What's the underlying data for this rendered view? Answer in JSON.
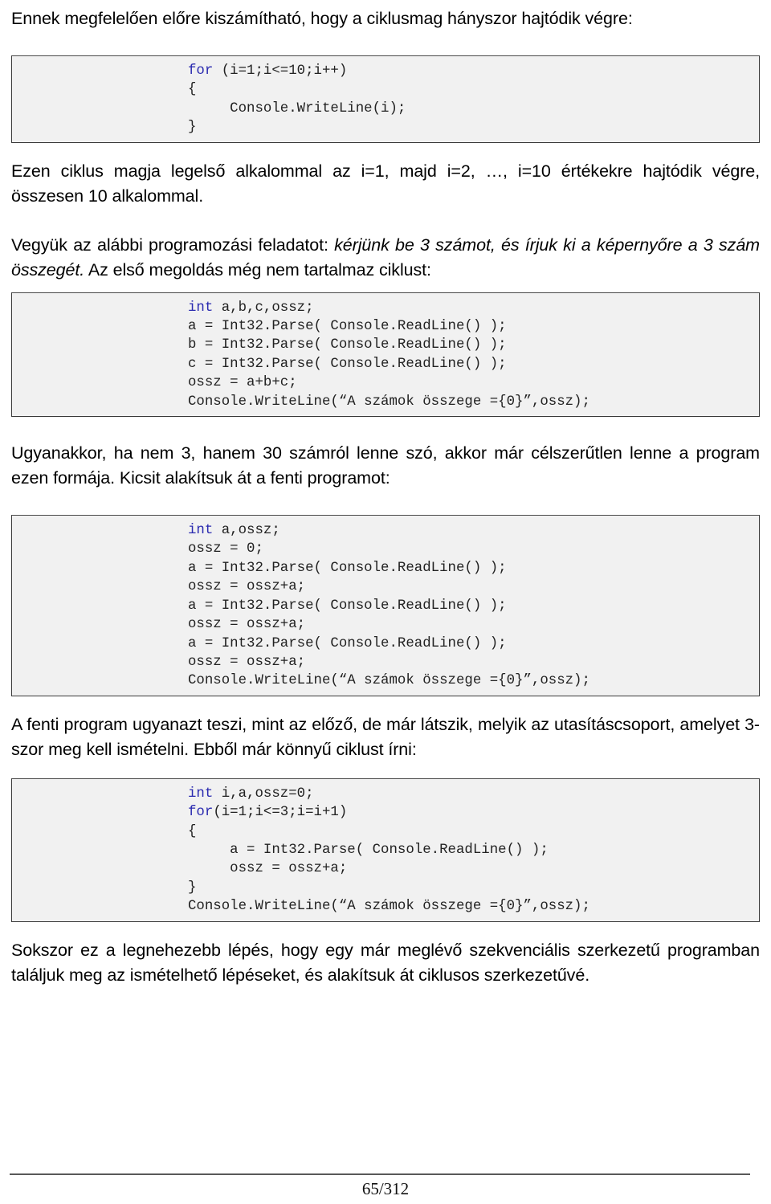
{
  "document": {
    "language": "hu",
    "page_number": "65/312"
  },
  "intro": {
    "heading": "Ennek megfelelően előre kiszámítható, hogy a ciklusmag hányszor hajtódik végre:"
  },
  "code_blocks": [
    {
      "id": "for-loop-10",
      "lines": [
        {
          "keyword": "for",
          "rest": " (i=1;i<=10;i++)"
        },
        {
          "keyword": "",
          "rest": "{"
        },
        {
          "keyword": "",
          "rest": "     Console.WriteLine(i);"
        },
        {
          "keyword": "",
          "rest": "}"
        }
      ]
    },
    {
      "id": "three-numbers-no-loop",
      "lines": [
        {
          "keyword": "int",
          "rest": " a,b,c,ossz;"
        },
        {
          "keyword": "",
          "rest": "a = Int32.Parse( Console.ReadLine() );"
        },
        {
          "keyword": "",
          "rest": "b = Int32.Parse( Console.ReadLine() );"
        },
        {
          "keyword": "",
          "rest": "c = Int32.Parse( Console.ReadLine() );"
        },
        {
          "keyword": "",
          "rest": "ossz = a+b+c;"
        },
        {
          "keyword": "",
          "rest": "Console.WriteLine(“A számok összege ={0}”,ossz);"
        }
      ]
    },
    {
      "id": "three-numbers-unrolled",
      "lines": [
        {
          "keyword": "int",
          "rest": " a,ossz;"
        },
        {
          "keyword": "",
          "rest": "ossz = 0;"
        },
        {
          "keyword": "",
          "rest": "a = Int32.Parse( Console.ReadLine() );"
        },
        {
          "keyword": "",
          "rest": "ossz = ossz+a;"
        },
        {
          "keyword": "",
          "rest": "a = Int32.Parse( Console.ReadLine() );"
        },
        {
          "keyword": "",
          "rest": "ossz = ossz+a;"
        },
        {
          "keyword": "",
          "rest": "a = Int32.Parse( Console.ReadLine() );"
        },
        {
          "keyword": "",
          "rest": "ossz = ossz+a;"
        },
        {
          "keyword": "",
          "rest": "Console.WriteLine(“A számok összege ={0}”,ossz);"
        }
      ]
    },
    {
      "id": "three-numbers-with-loop",
      "lines": [
        {
          "keyword": "int",
          "rest": " i,a,ossz=0;"
        },
        {
          "keyword": "for",
          "rest": "(i=1;i<=3;i=i+1)"
        },
        {
          "keyword": "",
          "rest": "{"
        },
        {
          "keyword": "",
          "rest": "     a = Int32.Parse( Console.ReadLine() );"
        },
        {
          "keyword": "",
          "rest": "     ossz = ossz+a;"
        },
        {
          "keyword": "",
          "rest": "}"
        },
        {
          "keyword": "",
          "rest": "Console.WriteLine(“A számok összege ={0}”,ossz);"
        }
      ]
    }
  ],
  "paragraphs": {
    "after_block1": "Ezen ciklus magja legelső alkalommal az i=1, majd i=2, …, i=10 értékekre hajtódik végre, összesen 10 alkalommal.",
    "task_lead": "Vegyük az alábbi programozási feladatot: ",
    "task_italic": "kérjünk be 3 számot, és írjuk ki a képernyőre a 3 szám összegét.",
    "task_tail": " Az első megoldás még nem tartalmaz ciklust:",
    "after_block2": "Ugyanakkor, ha nem 3, hanem 30 számról lenne szó, akkor már célszerűtlen lenne a program ezen formája.  Kicsit alakítsuk át a fenti programot:",
    "after_block3": "A fenti program ugyanazt teszi, mint az előző, de már látszik, melyik az utasításcsoport, amelyet 3-szor meg kell ismételni. Ebből már könnyű ciklust írni:",
    "closing": "Sokszor ez a legnehezebb lépés, hogy egy már meglévő szekvenciális szerkezetű programban találjuk meg az ismételhető lépéseket, és alakítsuk át ciklusos szerkezetűvé."
  },
  "colors": {
    "code_background": "#f1f1f1",
    "code_border": "#3a3a3a",
    "keyword": "#2b2bb0",
    "text": "#000000",
    "footer_rule": "#595959"
  }
}
